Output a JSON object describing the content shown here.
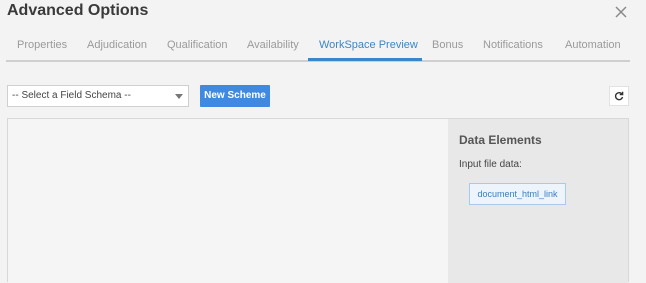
{
  "dialog": {
    "title": "Advanced Options"
  },
  "tabs": [
    {
      "label": "Properties",
      "active": false
    },
    {
      "label": "Adjudication",
      "active": false
    },
    {
      "label": "Qualification",
      "active": false
    },
    {
      "label": "Availability",
      "active": false
    },
    {
      "label": "WorkSpace Preview",
      "active": true
    },
    {
      "label": "Bonus",
      "active": false
    },
    {
      "label": "Notifications",
      "active": false
    },
    {
      "label": "Automation",
      "active": false
    }
  ],
  "toolbar": {
    "schema_select_value": "-- Select a Field Schema --",
    "new_scheme_label": "New Scheme"
  },
  "data_elements": {
    "title": "Data Elements",
    "input_label": "Input file data:",
    "items": [
      "document_html_link"
    ]
  },
  "colors": {
    "accent": "#3b86c9",
    "button": "#3f8ae0",
    "background": "#f3f3f3"
  }
}
